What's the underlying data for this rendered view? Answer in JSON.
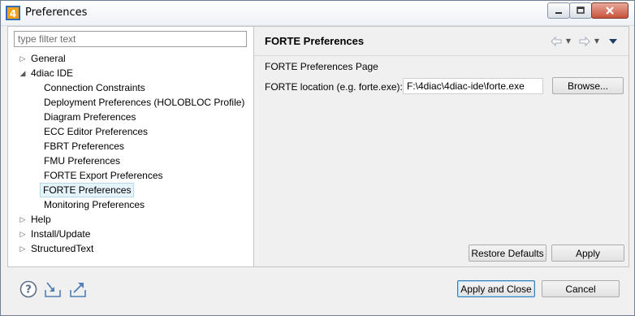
{
  "window": {
    "title": "Preferences"
  },
  "filter": {
    "placeholder": "type filter text"
  },
  "tree": {
    "items": [
      {
        "label": "General",
        "twisty": "▷"
      },
      {
        "label": "4diac IDE",
        "twisty": "◢"
      },
      {
        "label": "Connection Constraints"
      },
      {
        "label": "Deployment Preferences (HOLOBLOC Profile)"
      },
      {
        "label": "Diagram Preferences"
      },
      {
        "label": "ECC Editor Preferences"
      },
      {
        "label": "FBRT Preferences"
      },
      {
        "label": "FMU Preferences"
      },
      {
        "label": "FORTE Export Preferences"
      },
      {
        "label": "FORTE Preferences",
        "selected": true
      },
      {
        "label": "Monitoring Preferences"
      },
      {
        "label": "Help",
        "twisty": "▷"
      },
      {
        "label": "Install/Update",
        "twisty": "▷"
      },
      {
        "label": "StructuredText",
        "twisty": "▷"
      }
    ]
  },
  "page": {
    "title": "FORTE Preferences",
    "description": "FORTE Preferences Page",
    "location_label": "FORTE location (e.g. forte.exe):",
    "location_value": "F:\\4diac\\4diac-ide\\forte.exe",
    "browse_label": "Browse...",
    "restore_label": "Restore Defaults",
    "apply_label": "Apply"
  },
  "footer": {
    "apply_close_label": "Apply and Close",
    "cancel_label": "Cancel"
  },
  "icons": {
    "app": "4diac-app-icon",
    "help": "help-icon",
    "import": "import-icon",
    "export": "export-icon",
    "back": "back-arrow-icon",
    "forward": "forward-arrow-icon",
    "menu": "view-menu-icon"
  },
  "colors": {
    "selection_bg": "#e5f3fb",
    "selection_border": "#b7d9ed",
    "default_button_border": "#3c7fb1",
    "close_button": "#c7523c"
  }
}
